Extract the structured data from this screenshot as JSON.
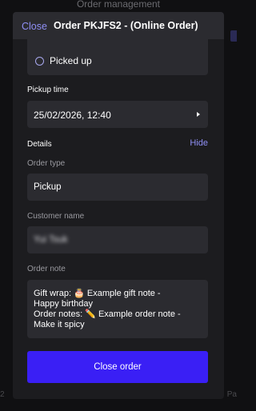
{
  "background": {
    "header_title": "Order management",
    "left_mark": "2",
    "right_mark": "Pa"
  },
  "modal": {
    "close_label": "Close",
    "title": "Order PKJFS2 - (Online Order)"
  },
  "status": {
    "option_label": "Picked up",
    "selected": false
  },
  "pickup": {
    "label": "Pickup time",
    "value": "25/02/2026, 12:40"
  },
  "details": {
    "label": "Details",
    "toggle_label": "Hide",
    "order_type_label": "Order type",
    "order_type_value": "Pickup",
    "customer_name_label": "Customer name",
    "customer_name_value": "Yui Tsuk",
    "order_note_label": "Order note",
    "order_note": {
      "line1_prefix": "Gift wrap: ",
      "line1_suffix": " Example gift note -",
      "line2": "Happy birthday",
      "line3_prefix": "Order notes: ",
      "line3_suffix": " Example order note -",
      "line4": "Make it spicy",
      "gift_emoji": "🎂",
      "note_emoji": "✏️"
    }
  },
  "actions": {
    "close_order_label": "Close order"
  },
  "colors": {
    "accent": "#8f8ff5",
    "primary_button": "#3a1ff5",
    "card": "#2b2b30",
    "modal": "#1c1c1f"
  },
  "icons": {
    "gift": "cake-icon",
    "note": "pencil-icon",
    "pickup_caret": "caret-right-icon",
    "status_radio": "radio-icon"
  }
}
